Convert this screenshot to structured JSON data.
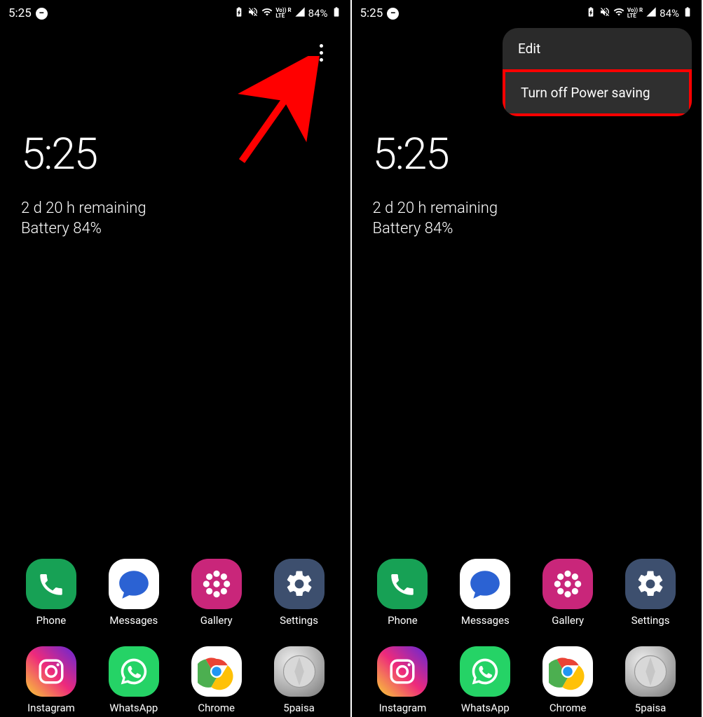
{
  "status": {
    "time": "5:25",
    "battery_label": "84%"
  },
  "clock": {
    "time": "5:25",
    "remaining": "2 d 20 h remaining",
    "battery": "Battery 84%"
  },
  "apps": {
    "row1": [
      {
        "label": "Phone"
      },
      {
        "label": "Messages"
      },
      {
        "label": "Gallery"
      },
      {
        "label": "Settings"
      }
    ],
    "row2": [
      {
        "label": "Instagram"
      },
      {
        "label": "WhatsApp"
      },
      {
        "label": "Chrome"
      },
      {
        "label": "5paisa"
      }
    ]
  },
  "popup": {
    "edit": "Edit",
    "power_saving": "Turn off Power saving"
  }
}
